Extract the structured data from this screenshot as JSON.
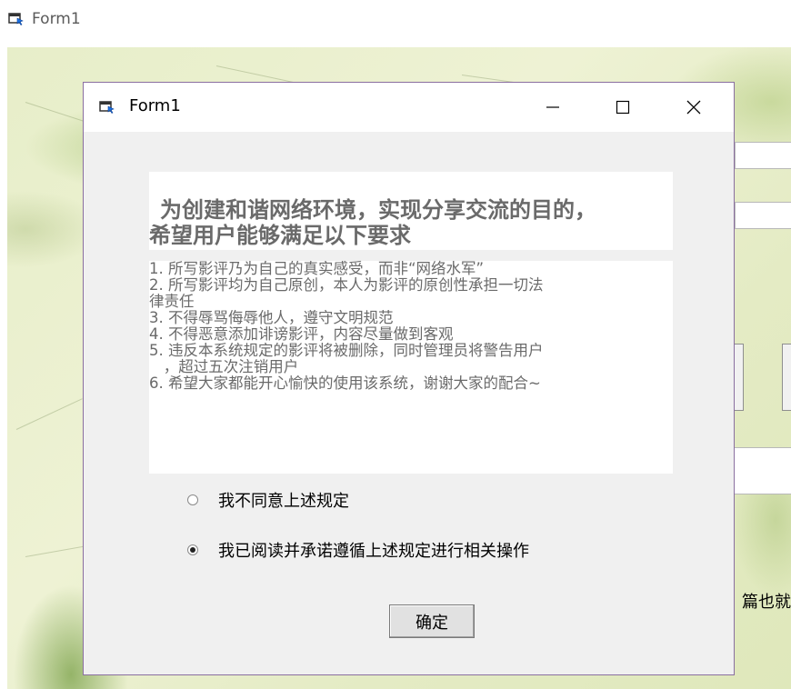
{
  "outer_window": {
    "title": "Form1",
    "icon": "form-icon"
  },
  "background_form": {
    "partial_text": "篇也就是"
  },
  "dialog": {
    "title": "Form1",
    "icon": "form-icon",
    "controls": {
      "minimize": "—",
      "maximize": "☐",
      "close": "✕"
    },
    "heading": {
      "line1": "为创建和谐网络环境，实现分享交流的目的，",
      "line2": "希望用户能够满足以下要求"
    },
    "rules": [
      "1. 所写影评乃为自己的真实感受，而非“网络水军”",
      "2. 所写影评均为自己原创，本人为影评的原创性承担一切法",
      "律责任",
      "3. 不得辱骂侮辱他人，遵守文明规范",
      "4. 不得恶意添加诽谤影评，内容尽量做到客观",
      "5. 违反本系统规定的影评将被删除，同时管理员将警告用户",
      "   ，超过五次注销用户",
      "6. 希望大家都能开心愉快的使用该系统，谢谢大家的配合~"
    ],
    "options": [
      {
        "label": "我不同意上述规定",
        "checked": false
      },
      {
        "label": "我已阅读并承诺遵循上述规定进行相关操作",
        "checked": true
      }
    ],
    "ok_button": "确定"
  },
  "colors": {
    "dialog_border": "#8a6fa0",
    "dialog_bg": "#f0f0f0",
    "panel_text": "#6a6a6a",
    "background_green": "#e7eec9"
  }
}
